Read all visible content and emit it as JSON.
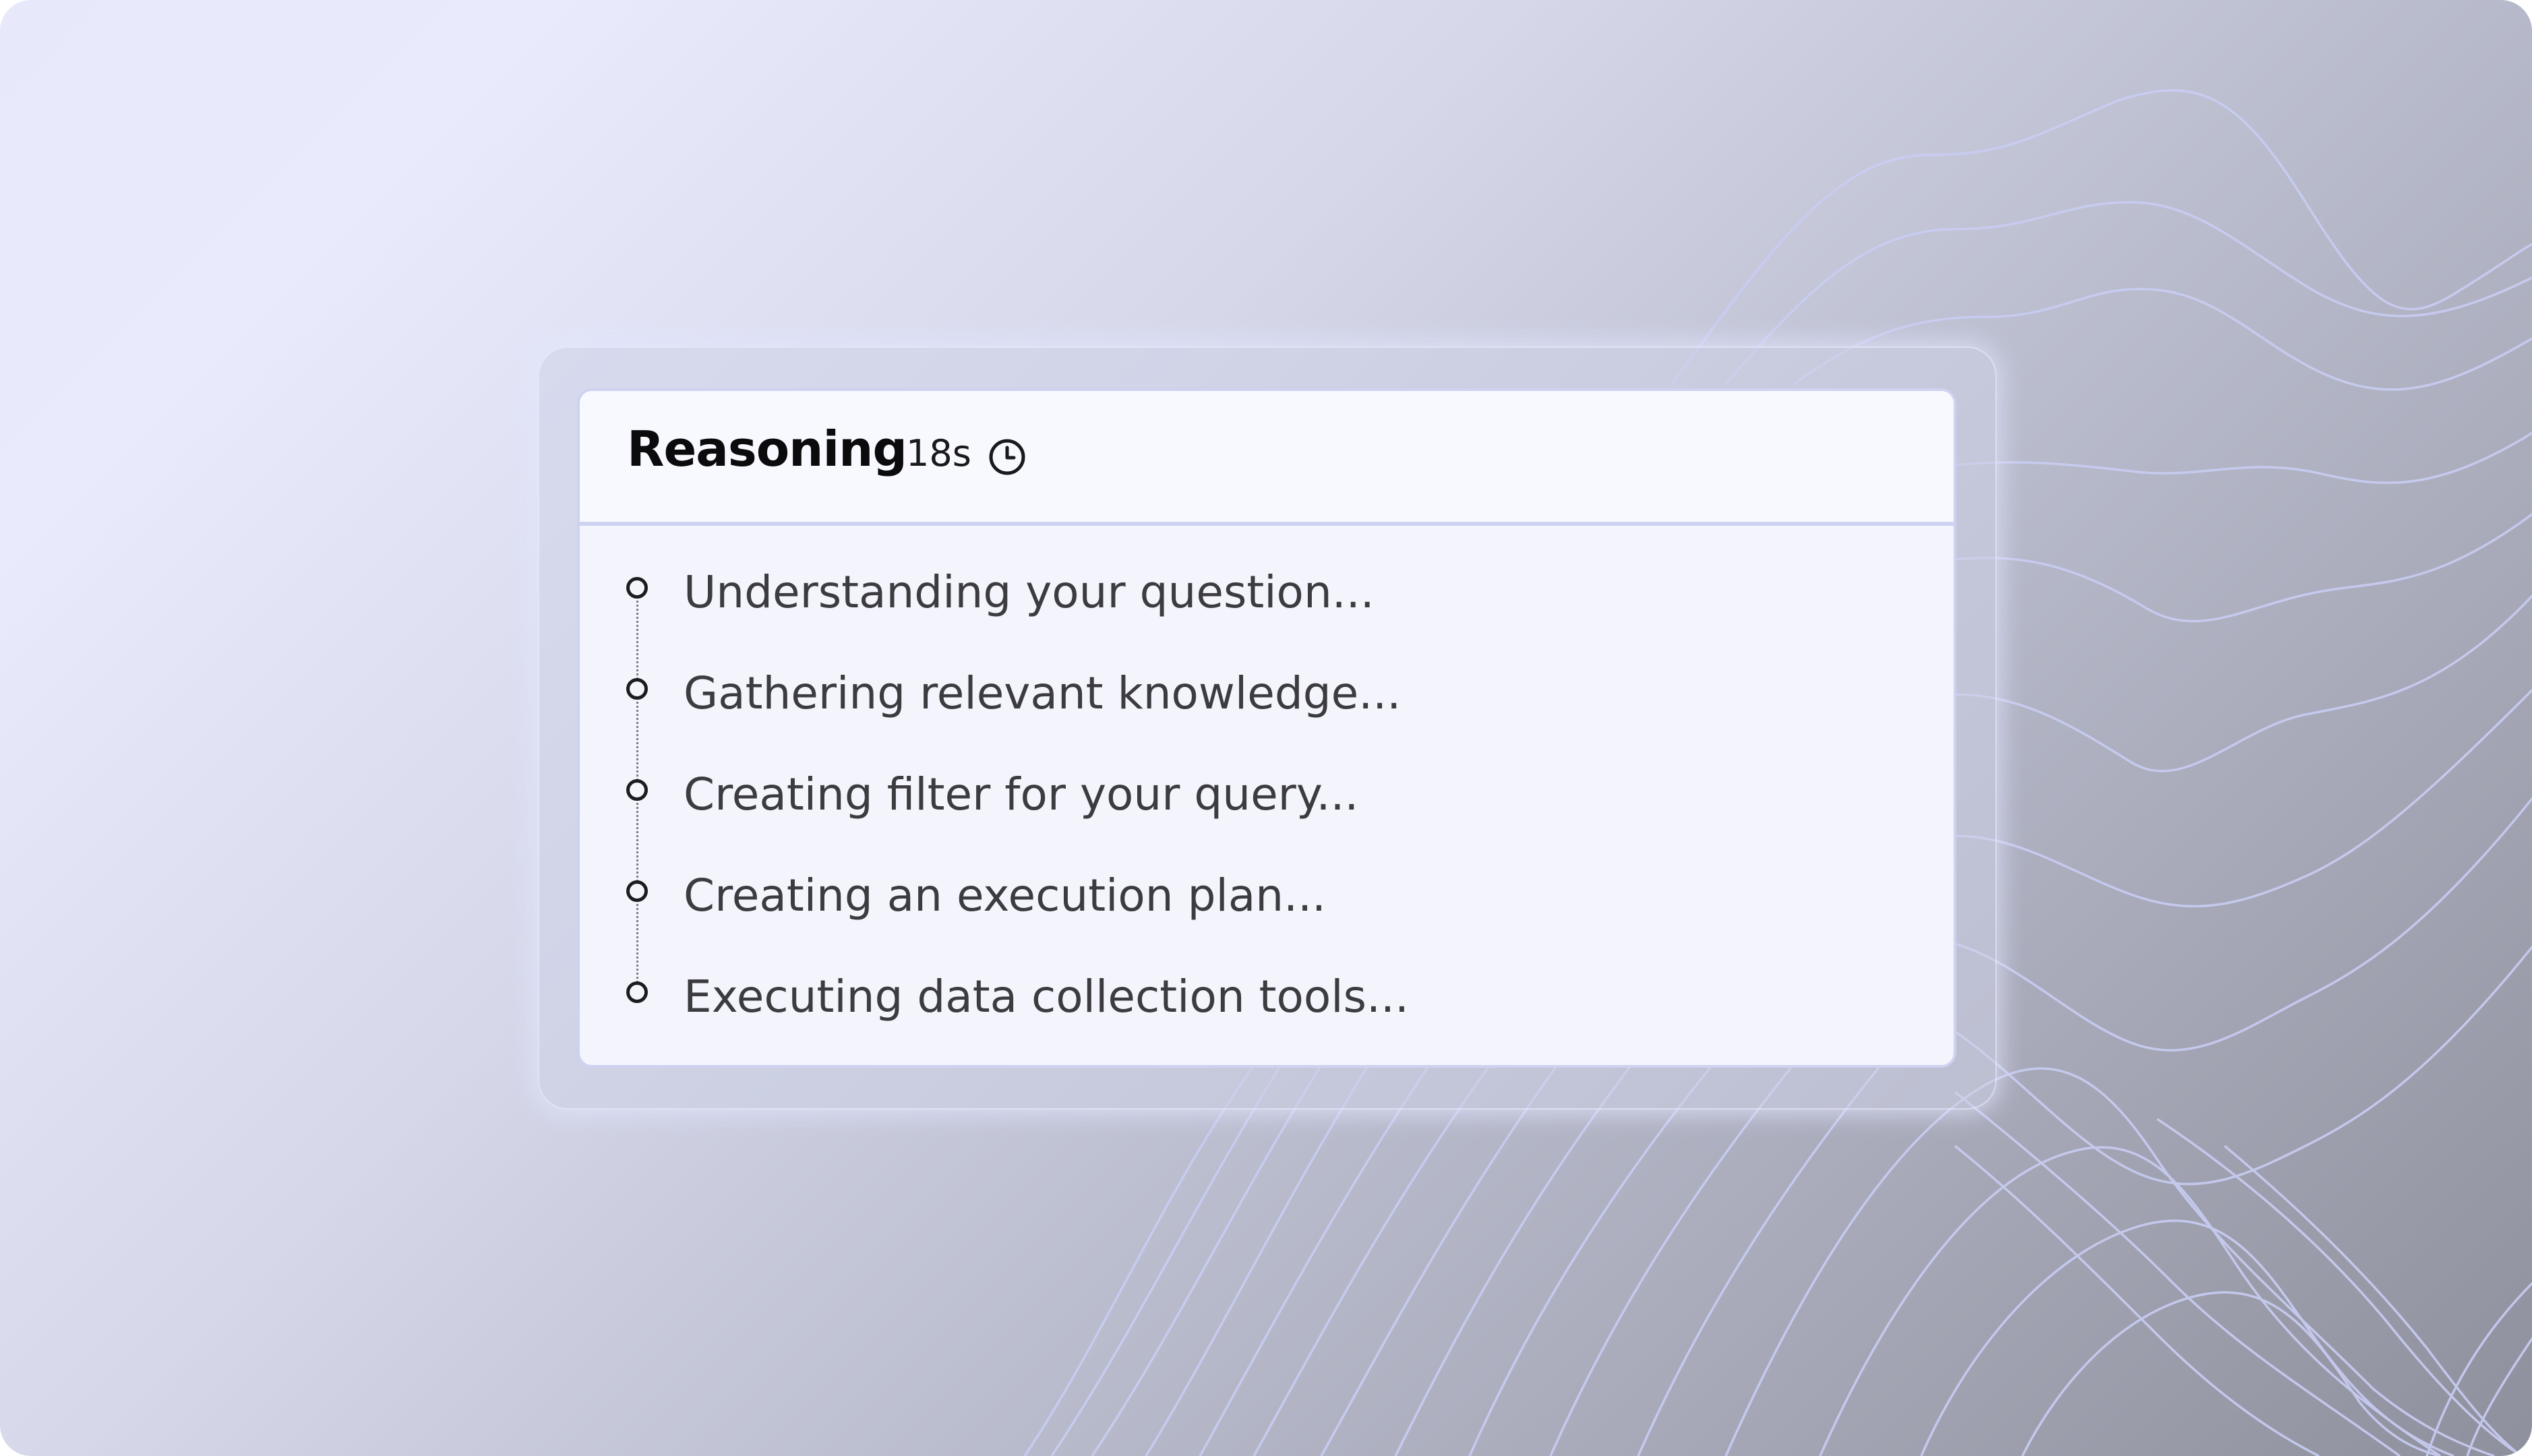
{
  "reasoning_panel": {
    "title": "Reasoning",
    "duration": "18s",
    "clock_icon": "clock-icon",
    "steps": [
      {
        "label": "Understanding your question..."
      },
      {
        "label": "Gathering relevant knowledge..."
      },
      {
        "label": "Creating filter for your query..."
      },
      {
        "label": "Creating an execution plan..."
      },
      {
        "label": "Executing data collection tools..."
      }
    ]
  },
  "colors": {
    "card_background": "#f3f4fc",
    "header_background": "#f8f9fe",
    "card_border": "#cdd2f0",
    "wave_lines": "#c9cdf3",
    "title_text": "#0b0b0d",
    "step_text": "#3b3b40"
  }
}
